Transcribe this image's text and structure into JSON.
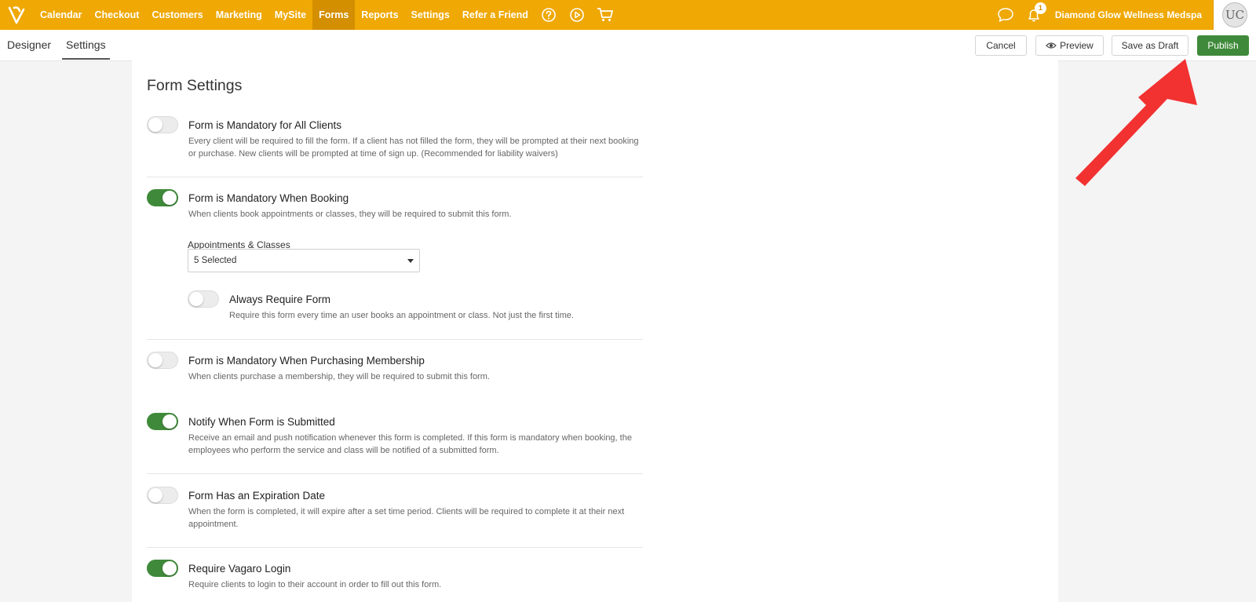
{
  "nav": {
    "items": [
      {
        "label": "Calendar"
      },
      {
        "label": "Checkout"
      },
      {
        "label": "Customers"
      },
      {
        "label": "Marketing"
      },
      {
        "label": "MySite"
      },
      {
        "label": "Forms",
        "active": true
      },
      {
        "label": "Reports"
      },
      {
        "label": "Settings"
      },
      {
        "label": "Refer a Friend"
      }
    ],
    "icons": [
      "help-icon",
      "play-icon",
      "cart-icon"
    ],
    "business_name": "Diamond Glow Wellness Medspa",
    "notification_count": "1",
    "avatar_initials": "UC"
  },
  "subnav": {
    "tabs": [
      {
        "label": "Designer"
      },
      {
        "label": "Settings",
        "active": true
      }
    ],
    "cancel_label": "Cancel",
    "preview_label": "Preview",
    "draft_label": "Save as Draft",
    "publish_label": "Publish"
  },
  "form_settings": {
    "title": "Form Settings",
    "items": [
      {
        "title": "Form is Mandatory for All Clients",
        "desc": "Every client will be required to fill the form. If a client has not filled the form, they will be prompted at their next booking or purchase. New clients will be prompted at time of sign up. (Recommended for liability waivers)",
        "enabled": false
      },
      {
        "title": "Form is Mandatory When Booking",
        "desc": "When clients book appointments or classes, they will be required to submit this form.",
        "enabled": true
      },
      {
        "title": "Always Require Form",
        "desc": "Require this form every time an user books an appointment or class. Not just the first time.",
        "enabled": false
      },
      {
        "title": "Form is Mandatory When Purchasing Membership",
        "desc": "When clients purchase a membership, they will be required to submit this form.",
        "enabled": false
      },
      {
        "title": "Notify When Form is Submitted",
        "desc": "Receive an email and push notification whenever this form is completed. If this form is mandatory when booking, the employees who perform the service and class will be notified of a submitted form.",
        "enabled": true
      },
      {
        "title": "Form Has an Expiration Date",
        "desc": "When the form is completed, it will expire after a set time period. Clients will be required to complete it at their next appointment.",
        "enabled": false
      },
      {
        "title": "Require Vagaro Login",
        "desc": "Require clients to login to their account in order to fill out this form.",
        "enabled": true
      }
    ],
    "appointments_label": "Appointments & Classes",
    "appointments_value": "5 Selected"
  },
  "colors": {
    "brand": "#efa804",
    "active_nav": "#d48f00",
    "toggle_on": "#3f8a3a",
    "publish": "#3f8a3a",
    "annotation_arrow": "#f23131"
  }
}
